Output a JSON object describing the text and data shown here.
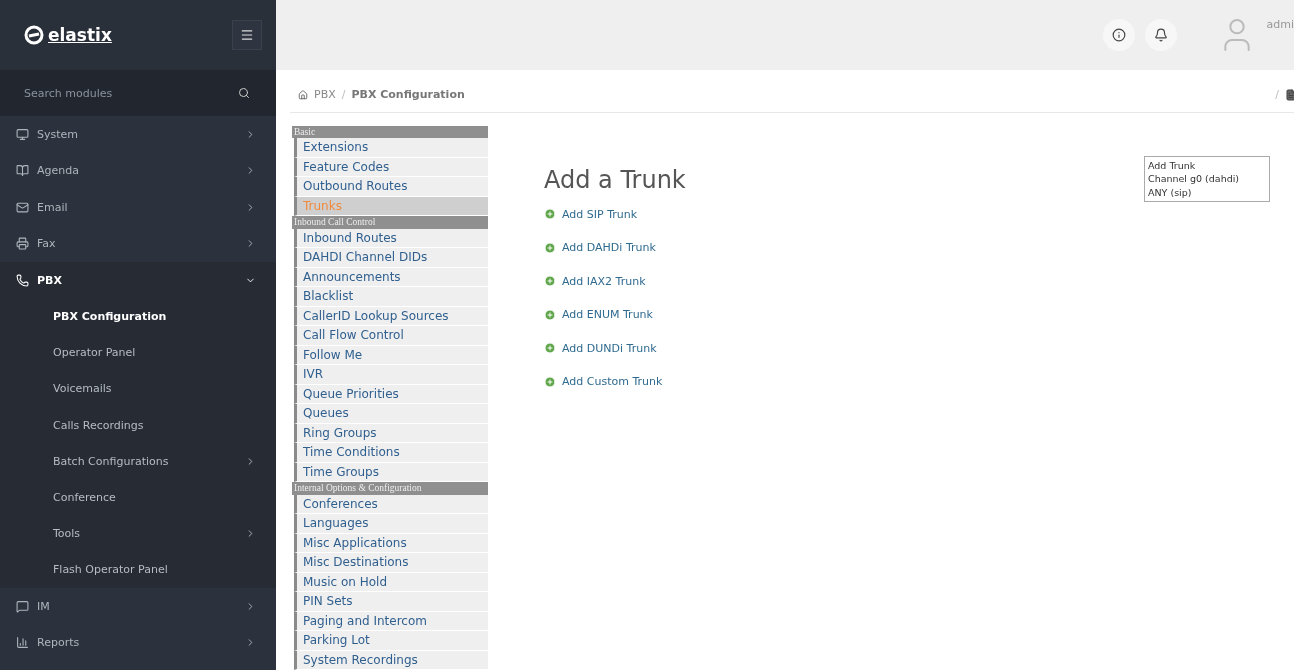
{
  "brand": {
    "name": "elastix"
  },
  "search": {
    "placeholder": "Search modules"
  },
  "nav": [
    {
      "kind": "monitor",
      "label": "System",
      "submenu": true,
      "expanded": false
    },
    {
      "kind": "book",
      "label": "Agenda",
      "submenu": true,
      "expanded": false
    },
    {
      "kind": "mail",
      "label": "Email",
      "submenu": true,
      "expanded": false
    },
    {
      "kind": "printer",
      "label": "Fax",
      "submenu": true,
      "expanded": false
    },
    {
      "kind": "phone",
      "label": "PBX",
      "submenu": true,
      "expanded": true,
      "children": [
        {
          "label": "PBX Configuration",
          "selected": true,
          "submenu": false
        },
        {
          "label": "Operator Panel",
          "selected": false,
          "submenu": false
        },
        {
          "label": "Voicemails",
          "selected": false,
          "submenu": false
        },
        {
          "label": "Calls Recordings",
          "selected": false,
          "submenu": false
        },
        {
          "label": "Batch Configurations",
          "selected": false,
          "submenu": true
        },
        {
          "label": "Conference",
          "selected": false,
          "submenu": false
        },
        {
          "label": "Tools",
          "selected": false,
          "submenu": true
        },
        {
          "label": "Flash Operator Panel",
          "selected": false,
          "submenu": false
        }
      ]
    },
    {
      "kind": "chat",
      "label": "IM",
      "submenu": true,
      "expanded": false
    },
    {
      "kind": "chart",
      "label": "Reports",
      "submenu": true,
      "expanded": false
    }
  ],
  "user": {
    "name": "admi"
  },
  "breadcrumb": [
    "PBX",
    "PBX Configuration"
  ],
  "breadcrumb_separator": "/",
  "breadcrumb_end": "/",
  "menu": [
    {
      "title": "Basic",
      "items": [
        {
          "label": "Extensions",
          "selected": false
        },
        {
          "label": "Feature Codes",
          "selected": false
        },
        {
          "label": "Outbound Routes",
          "selected": false
        },
        {
          "label": "Trunks",
          "selected": true
        }
      ]
    },
    {
      "title": "Inbound Call Control",
      "items": [
        {
          "label": "Inbound Routes",
          "selected": false
        },
        {
          "label": "DAHDI Channel DIDs",
          "selected": false
        },
        {
          "label": "Announcements",
          "selected": false
        },
        {
          "label": "Blacklist",
          "selected": false
        },
        {
          "label": "CallerID Lookup Sources",
          "selected": false
        },
        {
          "label": "Call Flow Control",
          "selected": false
        },
        {
          "label": "Follow Me",
          "selected": false
        },
        {
          "label": "IVR",
          "selected": false
        },
        {
          "label": "Queue Priorities",
          "selected": false
        },
        {
          "label": "Queues",
          "selected": false
        },
        {
          "label": "Ring Groups",
          "selected": false
        },
        {
          "label": "Time Conditions",
          "selected": false
        },
        {
          "label": "Time Groups",
          "selected": false
        }
      ]
    },
    {
      "title": "Internal Options & Configuration",
      "items": [
        {
          "label": "Conferences",
          "selected": false
        },
        {
          "label": "Languages",
          "selected": false
        },
        {
          "label": "Misc Applications",
          "selected": false
        },
        {
          "label": "Misc Destinations",
          "selected": false
        },
        {
          "label": "Music on Hold",
          "selected": false
        },
        {
          "label": "PIN Sets",
          "selected": false
        },
        {
          "label": "Paging and Intercom",
          "selected": false
        },
        {
          "label": "Parking Lot",
          "selected": false
        },
        {
          "label": "System Recordings",
          "selected": false
        }
      ]
    }
  ],
  "heading": "Add a Trunk",
  "add_links": [
    "Add SIP Trunk",
    "Add DAHDi Trunk",
    "Add IAX2 Trunk",
    "Add ENUM Trunk",
    "Add DUNDi Trunk",
    "Add Custom Trunk"
  ],
  "trunk_list": [
    {
      "label": "Add Trunk",
      "selected": false
    },
    {
      "label": "Channel g0 (dahdi)",
      "selected": false
    },
    {
      "label": "ANY (sip)",
      "selected": false
    }
  ]
}
